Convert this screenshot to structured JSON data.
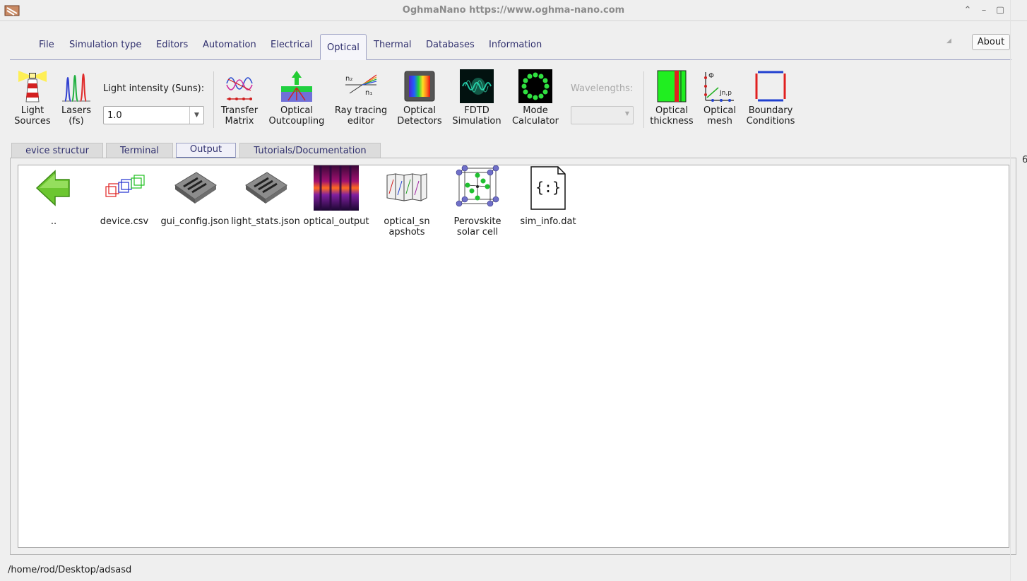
{
  "window": {
    "title": "OghmaNano https://www.oghma-nano.com",
    "minimize": "⌃",
    "restore": "–",
    "maximize": "▢"
  },
  "menu": {
    "items": [
      "File",
      "Simulation type",
      "Editors",
      "Automation",
      "Electrical",
      "Optical",
      "Thermal",
      "Databases",
      "Information"
    ],
    "active": "Optical",
    "about": "About"
  },
  "toolbar": {
    "light_sources": [
      "Light",
      "Sources"
    ],
    "lasers": [
      "Lasers",
      "(fs)"
    ],
    "light_intensity_label": "Light intensity (Suns):",
    "light_intensity_value": "1.0",
    "transfer_matrix": [
      "Transfer",
      "Matrix"
    ],
    "optical_outcoupling": [
      "Optical",
      "Outcoupling"
    ],
    "ray_tracing": [
      "Ray tracing",
      "editor"
    ],
    "optical_detectors": [
      "Optical",
      "Detectors"
    ],
    "fdtd": [
      "FDTD",
      "Simulation"
    ],
    "mode_calculator": [
      "Mode",
      "Calculator"
    ],
    "wavelengths_label": "Wavelengths:",
    "optical_thickness": [
      "Optical",
      "thickness"
    ],
    "optical_mesh": [
      "Optical",
      "mesh"
    ],
    "boundary_conditions": [
      "Boundary",
      "Conditions"
    ]
  },
  "subtabs": {
    "items": [
      "evice structur",
      "Terminal",
      "Output",
      "Tutorials/Documentation"
    ],
    "active": "Output"
  },
  "files": [
    {
      "name": "..",
      "icon": "back-arrow-icon"
    },
    {
      "name": "device.csv",
      "icon": "cubes-icon"
    },
    {
      "name": "gui_config.json",
      "icon": "device-grid-icon"
    },
    {
      "name": "light_stats.json",
      "icon": "device-grid-icon"
    },
    {
      "name": "optical_output",
      "icon": "optical-image-icon"
    },
    {
      "name": "optical_sn apshots",
      "icon": "snapshots-icon"
    },
    {
      "name": "Perovskite solar cell",
      "icon": "crystal-lattice-icon"
    },
    {
      "name": "sim_info.dat",
      "icon": "json-file-icon"
    }
  ],
  "status": {
    "path": "/home/rod/Desktop/adsasd"
  },
  "edge_char": "6"
}
